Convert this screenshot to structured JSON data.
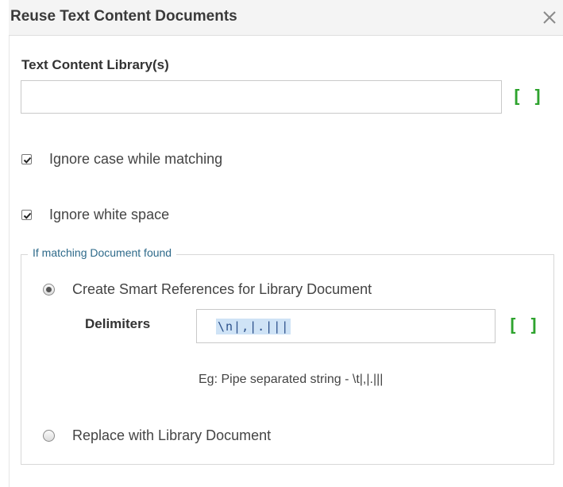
{
  "dialog": {
    "title": "Reuse Text Content Documents",
    "close_icon": "close-icon"
  },
  "library": {
    "label": "Text Content Library(s)",
    "value": "",
    "button_label": "[ ]"
  },
  "options": {
    "ignore_case": {
      "label": "Ignore case while matching",
      "checked": true
    },
    "ignore_whitespace": {
      "label": "Ignore white space",
      "checked": true
    }
  },
  "matching": {
    "legend": "If matching Document found",
    "create_refs": {
      "label": "Create Smart References for Library Document",
      "selected": true
    },
    "delimiters": {
      "label": "Delimiters",
      "value": "\\n|,|.|||",
      "button_label": "[ ]",
      "hint": "Eg: Pipe separated string - \\t|,|.|||"
    },
    "replace": {
      "label": "Replace with Library Document",
      "selected": false
    }
  },
  "colors": {
    "bracket_green": "#2ea32e",
    "legend_blue": "#2e6a8a",
    "selection_bg": "#cfe3f6"
  }
}
